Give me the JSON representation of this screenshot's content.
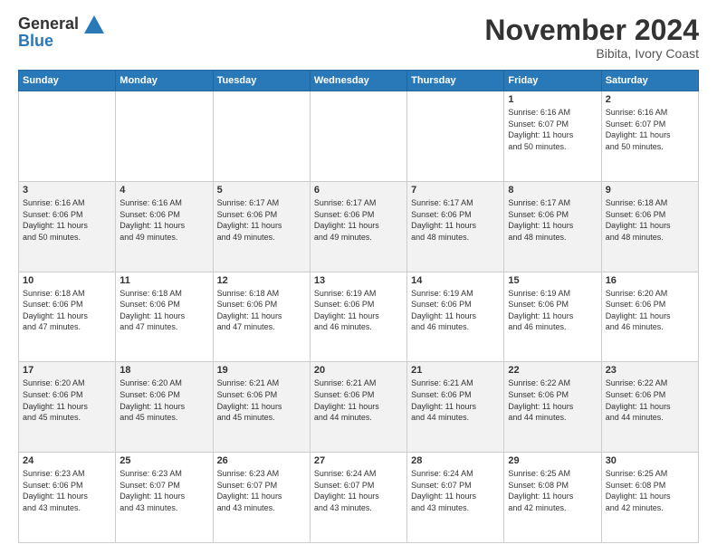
{
  "header": {
    "logo_line1": "General",
    "logo_line2": "Blue",
    "month_title": "November 2024",
    "location": "Bibita, Ivory Coast"
  },
  "weekdays": [
    "Sunday",
    "Monday",
    "Tuesday",
    "Wednesday",
    "Thursday",
    "Friday",
    "Saturday"
  ],
  "weeks": [
    [
      {
        "day": "",
        "info": ""
      },
      {
        "day": "",
        "info": ""
      },
      {
        "day": "",
        "info": ""
      },
      {
        "day": "",
        "info": ""
      },
      {
        "day": "",
        "info": ""
      },
      {
        "day": "1",
        "info": "Sunrise: 6:16 AM\nSunset: 6:07 PM\nDaylight: 11 hours\nand 50 minutes."
      },
      {
        "day": "2",
        "info": "Sunrise: 6:16 AM\nSunset: 6:07 PM\nDaylight: 11 hours\nand 50 minutes."
      }
    ],
    [
      {
        "day": "3",
        "info": "Sunrise: 6:16 AM\nSunset: 6:06 PM\nDaylight: 11 hours\nand 50 minutes."
      },
      {
        "day": "4",
        "info": "Sunrise: 6:16 AM\nSunset: 6:06 PM\nDaylight: 11 hours\nand 49 minutes."
      },
      {
        "day": "5",
        "info": "Sunrise: 6:17 AM\nSunset: 6:06 PM\nDaylight: 11 hours\nand 49 minutes."
      },
      {
        "day": "6",
        "info": "Sunrise: 6:17 AM\nSunset: 6:06 PM\nDaylight: 11 hours\nand 49 minutes."
      },
      {
        "day": "7",
        "info": "Sunrise: 6:17 AM\nSunset: 6:06 PM\nDaylight: 11 hours\nand 48 minutes."
      },
      {
        "day": "8",
        "info": "Sunrise: 6:17 AM\nSunset: 6:06 PM\nDaylight: 11 hours\nand 48 minutes."
      },
      {
        "day": "9",
        "info": "Sunrise: 6:18 AM\nSunset: 6:06 PM\nDaylight: 11 hours\nand 48 minutes."
      }
    ],
    [
      {
        "day": "10",
        "info": "Sunrise: 6:18 AM\nSunset: 6:06 PM\nDaylight: 11 hours\nand 47 minutes."
      },
      {
        "day": "11",
        "info": "Sunrise: 6:18 AM\nSunset: 6:06 PM\nDaylight: 11 hours\nand 47 minutes."
      },
      {
        "day": "12",
        "info": "Sunrise: 6:18 AM\nSunset: 6:06 PM\nDaylight: 11 hours\nand 47 minutes."
      },
      {
        "day": "13",
        "info": "Sunrise: 6:19 AM\nSunset: 6:06 PM\nDaylight: 11 hours\nand 46 minutes."
      },
      {
        "day": "14",
        "info": "Sunrise: 6:19 AM\nSunset: 6:06 PM\nDaylight: 11 hours\nand 46 minutes."
      },
      {
        "day": "15",
        "info": "Sunrise: 6:19 AM\nSunset: 6:06 PM\nDaylight: 11 hours\nand 46 minutes."
      },
      {
        "day": "16",
        "info": "Sunrise: 6:20 AM\nSunset: 6:06 PM\nDaylight: 11 hours\nand 46 minutes."
      }
    ],
    [
      {
        "day": "17",
        "info": "Sunrise: 6:20 AM\nSunset: 6:06 PM\nDaylight: 11 hours\nand 45 minutes."
      },
      {
        "day": "18",
        "info": "Sunrise: 6:20 AM\nSunset: 6:06 PM\nDaylight: 11 hours\nand 45 minutes."
      },
      {
        "day": "19",
        "info": "Sunrise: 6:21 AM\nSunset: 6:06 PM\nDaylight: 11 hours\nand 45 minutes."
      },
      {
        "day": "20",
        "info": "Sunrise: 6:21 AM\nSunset: 6:06 PM\nDaylight: 11 hours\nand 44 minutes."
      },
      {
        "day": "21",
        "info": "Sunrise: 6:21 AM\nSunset: 6:06 PM\nDaylight: 11 hours\nand 44 minutes."
      },
      {
        "day": "22",
        "info": "Sunrise: 6:22 AM\nSunset: 6:06 PM\nDaylight: 11 hours\nand 44 minutes."
      },
      {
        "day": "23",
        "info": "Sunrise: 6:22 AM\nSunset: 6:06 PM\nDaylight: 11 hours\nand 44 minutes."
      }
    ],
    [
      {
        "day": "24",
        "info": "Sunrise: 6:23 AM\nSunset: 6:06 PM\nDaylight: 11 hours\nand 43 minutes."
      },
      {
        "day": "25",
        "info": "Sunrise: 6:23 AM\nSunset: 6:07 PM\nDaylight: 11 hours\nand 43 minutes."
      },
      {
        "day": "26",
        "info": "Sunrise: 6:23 AM\nSunset: 6:07 PM\nDaylight: 11 hours\nand 43 minutes."
      },
      {
        "day": "27",
        "info": "Sunrise: 6:24 AM\nSunset: 6:07 PM\nDaylight: 11 hours\nand 43 minutes."
      },
      {
        "day": "28",
        "info": "Sunrise: 6:24 AM\nSunset: 6:07 PM\nDaylight: 11 hours\nand 43 minutes."
      },
      {
        "day": "29",
        "info": "Sunrise: 6:25 AM\nSunset: 6:08 PM\nDaylight: 11 hours\nand 42 minutes."
      },
      {
        "day": "30",
        "info": "Sunrise: 6:25 AM\nSunset: 6:08 PM\nDaylight: 11 hours\nand 42 minutes."
      }
    ]
  ]
}
